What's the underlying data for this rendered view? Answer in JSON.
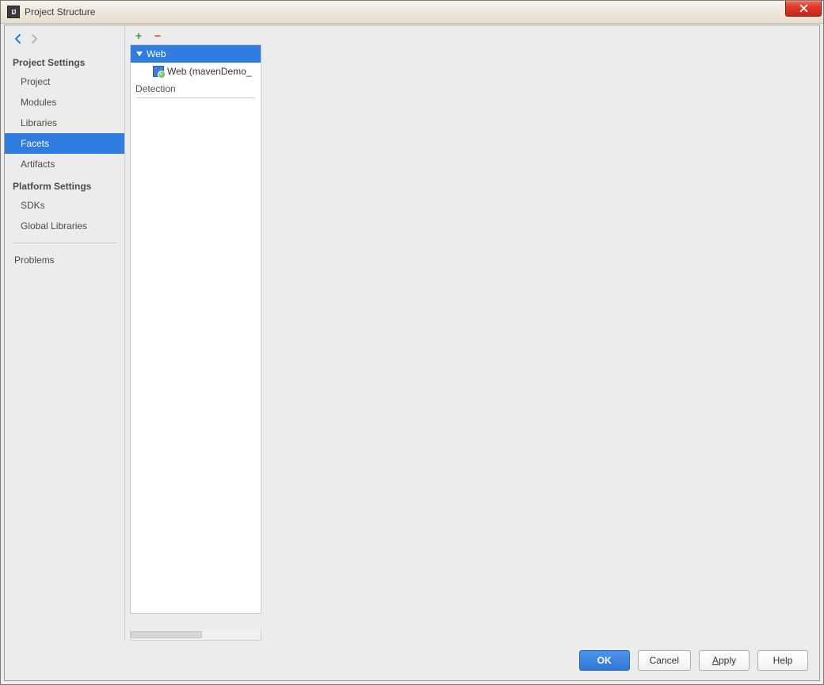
{
  "window": {
    "title": "Project Structure"
  },
  "leftnav": {
    "back_enabled": true,
    "forward_enabled": false,
    "section1": "Project Settings",
    "items1": [
      "Project",
      "Modules",
      "Libraries",
      "Facets",
      "Artifacts"
    ],
    "section2": "Platform Settings",
    "items2": [
      "SDKs",
      "Global Libraries"
    ],
    "section3_items": [
      "Problems"
    ],
    "selected": "Facets"
  },
  "facets": {
    "add_icon": "add-icon",
    "remove_icon": "remove-icon",
    "tree": {
      "root": {
        "label": "Web",
        "expanded": true,
        "selected": true
      },
      "children": [
        {
          "label": "Web (mavenDemo_"
        }
      ]
    },
    "detection_label": "Detection"
  },
  "buttons": {
    "ok": "OK",
    "cancel": "Cancel",
    "apply": "Apply",
    "help": "Help"
  },
  "colors": {
    "selection": "#2f7de1",
    "add": "#3c9a3c",
    "remove": "#c23a2a",
    "close": "#d7321f"
  }
}
